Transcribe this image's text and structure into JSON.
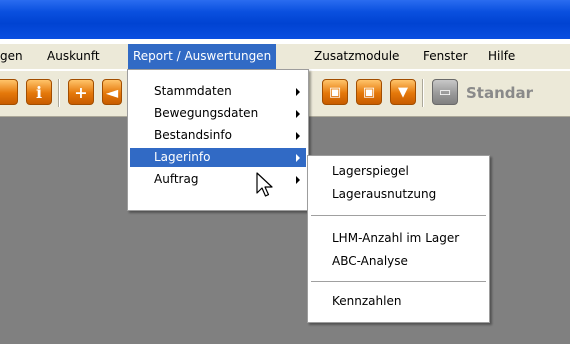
{
  "menubar": {
    "items": [
      {
        "label": "gen"
      },
      {
        "label": "Auskunft"
      },
      {
        "label": "Report / Auswertungen"
      },
      {
        "label": "Zusatzmodule"
      },
      {
        "label": "Fenster"
      },
      {
        "label": "Hilfe"
      }
    ]
  },
  "toolbar": {
    "buttons": [
      {
        "icon": "info-icon",
        "glyph": "i"
      },
      {
        "icon": "add-icon",
        "glyph": "+"
      },
      {
        "icon": "arrow-icon",
        "glyph": "◄"
      },
      {
        "icon": "copy-icon",
        "glyph": "▣"
      },
      {
        "icon": "paste-icon",
        "glyph": "▣"
      },
      {
        "icon": "diamond-icon",
        "glyph": "▼"
      },
      {
        "icon": "standard-icon",
        "glyph": "▭"
      }
    ],
    "standard_label": "Standar"
  },
  "report_menu": {
    "items": [
      {
        "label": "Stammdaten",
        "submenu": true
      },
      {
        "label": "Bewegungsdaten",
        "submenu": true
      },
      {
        "label": "Bestandsinfo",
        "submenu": true
      },
      {
        "label": "Lagerinfo",
        "submenu": true
      },
      {
        "label": "Auftrag",
        "submenu": true
      }
    ]
  },
  "lagerinfo_menu": {
    "items": [
      {
        "label": "Lagerspiegel"
      },
      {
        "label": "Lagerausnutzung"
      },
      {
        "label": "LHM-Anzahl im Lager"
      },
      {
        "label": "ABC-Analyse"
      },
      {
        "label": "Kennzahlen"
      }
    ]
  },
  "colors": {
    "titlebar": "#0a50df",
    "highlight": "#316ac5",
    "menu_face": "#ece9d8",
    "workspace": "#808080"
  }
}
